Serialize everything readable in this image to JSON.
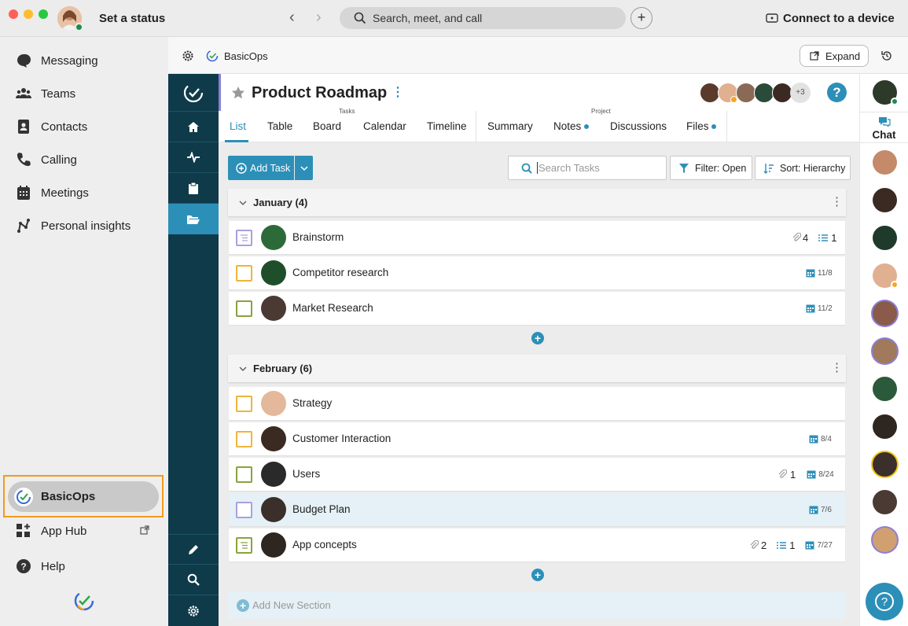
{
  "window": {
    "status_text": "Set a status",
    "search_placeholder": "Search, meet, and call",
    "connect_label": "Connect to a device"
  },
  "sidebar": {
    "items": [
      {
        "label": "Messaging",
        "icon": "chat-bubble-icon"
      },
      {
        "label": "Teams",
        "icon": "people-icon"
      },
      {
        "label": "Contacts",
        "icon": "contacts-icon"
      },
      {
        "label": "Calling",
        "icon": "phone-icon"
      },
      {
        "label": "Meetings",
        "icon": "calendar-icon"
      },
      {
        "label": "Personal insights",
        "icon": "insights-icon"
      }
    ],
    "active_app": "BasicOps",
    "app_hub": "App Hub",
    "help": "Help"
  },
  "app_bar": {
    "app_name": "BasicOps",
    "expand_label": "Expand"
  },
  "project": {
    "title": "Product Roadmap",
    "more_members": "+3",
    "tasks_group_label": "Tasks",
    "project_group_label": "Project",
    "tabs": [
      "List",
      "Table",
      "Board",
      "Calendar",
      "Timeline",
      "Summary",
      "Notes",
      "Discussions",
      "Files"
    ],
    "active_tab": "List"
  },
  "toolbar": {
    "add_task": "Add Task",
    "search_placeholder": "Search Tasks",
    "filter": "Filter: Open",
    "sort": "Sort: Hierarchy"
  },
  "sections": [
    {
      "title": "January (4)",
      "tasks": [
        {
          "name": "Brainstorm",
          "attachments": "4",
          "subtasks": "1",
          "date": ""
        },
        {
          "name": "Competitor research",
          "attachments": "",
          "subtasks": "",
          "date": "11/8"
        },
        {
          "name": "Market Research",
          "attachments": "",
          "subtasks": "",
          "date": "11/2"
        }
      ]
    },
    {
      "title": "February (6)",
      "tasks": [
        {
          "name": "Strategy",
          "attachments": "",
          "subtasks": "",
          "date": ""
        },
        {
          "name": "Customer Interaction",
          "attachments": "",
          "subtasks": "",
          "date": "8/4"
        },
        {
          "name": "Users",
          "attachments": "1",
          "subtasks": "",
          "date": "8/24"
        },
        {
          "name": "Budget Plan",
          "attachments": "",
          "subtasks": "",
          "date": "7/6"
        },
        {
          "name": "App concepts",
          "attachments": "2",
          "subtasks": "1",
          "date": "7/27"
        }
      ]
    }
  ],
  "add_section": "Add New Section",
  "rightbar": {
    "chat_label": "Chat"
  },
  "colors": {
    "dark_nav": "#0f3a4a",
    "accent_blue": "#2c8fb8",
    "highlight_orange": "#f39a1e",
    "task_yellow": "#f0b43c",
    "task_olive": "#8aa33a",
    "task_purple": "#a9a0e0"
  }
}
